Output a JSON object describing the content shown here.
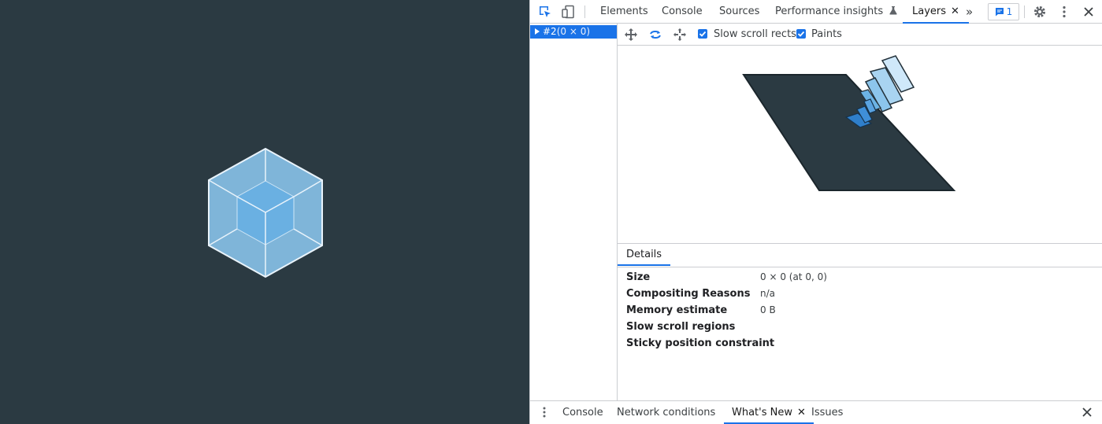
{
  "toolbar": {
    "tabs": [
      {
        "label": "Elements"
      },
      {
        "label": "Console"
      },
      {
        "label": "Sources"
      },
      {
        "label": "Performance insights"
      },
      {
        "label": "Layers",
        "active": true
      }
    ],
    "close_glyph": "✕",
    "more_tabs_glyph": "»",
    "issues_count": "1",
    "icons": [
      "inspect-element-icon",
      "device-toolbar-icon",
      "flask-icon",
      "chat-icon",
      "gear-icon",
      "kebab-menu-icon",
      "close-icon"
    ]
  },
  "layers_tree": {
    "selected": {
      "id": "#2",
      "size": "(0 × 0)"
    }
  },
  "viewer_toolbar": {
    "icons": [
      "pan-icon",
      "rotate-icon",
      "reset-view-icon"
    ],
    "checkboxes": [
      {
        "label": "Slow scroll rects",
        "checked": true
      },
      {
        "label": "Paints",
        "checked": true
      }
    ]
  },
  "details": {
    "tab_label": "Details",
    "rows": [
      {
        "key": "Size",
        "value": "0 × 0 (at 0, 0)"
      },
      {
        "key": "Compositing Reasons",
        "value": "n/a"
      },
      {
        "key": "Memory estimate",
        "value": "0 B"
      },
      {
        "key": "Slow scroll regions",
        "value": ""
      },
      {
        "key": "Sticky position constraint",
        "value": ""
      }
    ]
  },
  "drawer": {
    "tabs": [
      {
        "label": "Console"
      },
      {
        "label": "Network conditions"
      },
      {
        "label": "What's New",
        "active": true
      },
      {
        "label": "Issues"
      }
    ],
    "close_glyph": "✕"
  },
  "colors": {
    "page_background": "#2b3a42",
    "accent": "#1a73e8",
    "cube_fill": "#8ed6fb"
  }
}
